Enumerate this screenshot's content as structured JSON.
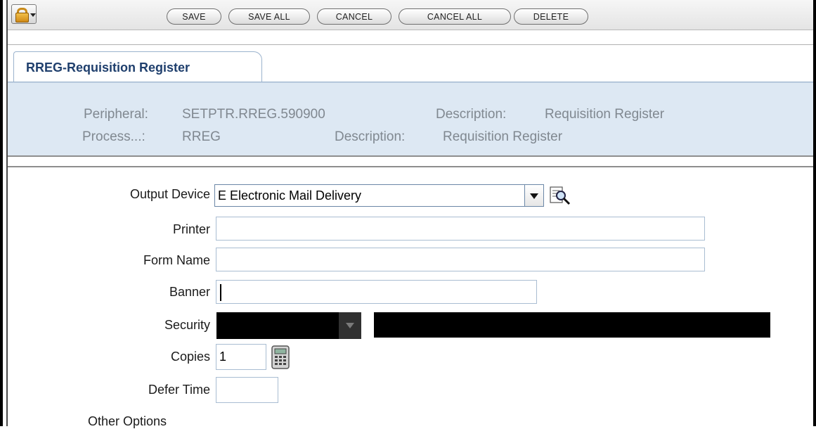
{
  "toolbar": {
    "lock_icon": "padlock-icon",
    "buttons": [
      {
        "label": "SAVE"
      },
      {
        "label": "SAVE ALL"
      },
      {
        "label": "CANCEL"
      },
      {
        "label": "CANCEL ALL"
      },
      {
        "label": "DELETE"
      }
    ]
  },
  "tab": {
    "label": "RREG-Requisition Register"
  },
  "info": {
    "peripheral_label": "Peripheral:",
    "peripheral_value": "SETPTR.RREG.590900",
    "peripheral_desc_label": "Description:",
    "peripheral_desc_value": "Requisition Register",
    "process_label": "Process...:",
    "process_value": "RREG",
    "process_desc_label": "Description:",
    "process_desc_value": "Requisition Register"
  },
  "form": {
    "output_device_label": "Output Device",
    "output_device_value": "E Electronic Mail Delivery",
    "printer_label": "Printer",
    "printer_value": "",
    "form_name_label": "Form Name",
    "form_name_value": "",
    "banner_label": "Banner",
    "banner_value": "",
    "security_label": "Security",
    "copies_label": "Copies",
    "copies_value": "1",
    "defer_time_label": "Defer Time",
    "defer_time_value": "",
    "other_options_label": "Other Options"
  },
  "colors": {
    "tab_text": "#1f3f6d",
    "info_bg": "#dde8f3",
    "info_text": "#808890",
    "field_border": "#a9bdd2"
  }
}
